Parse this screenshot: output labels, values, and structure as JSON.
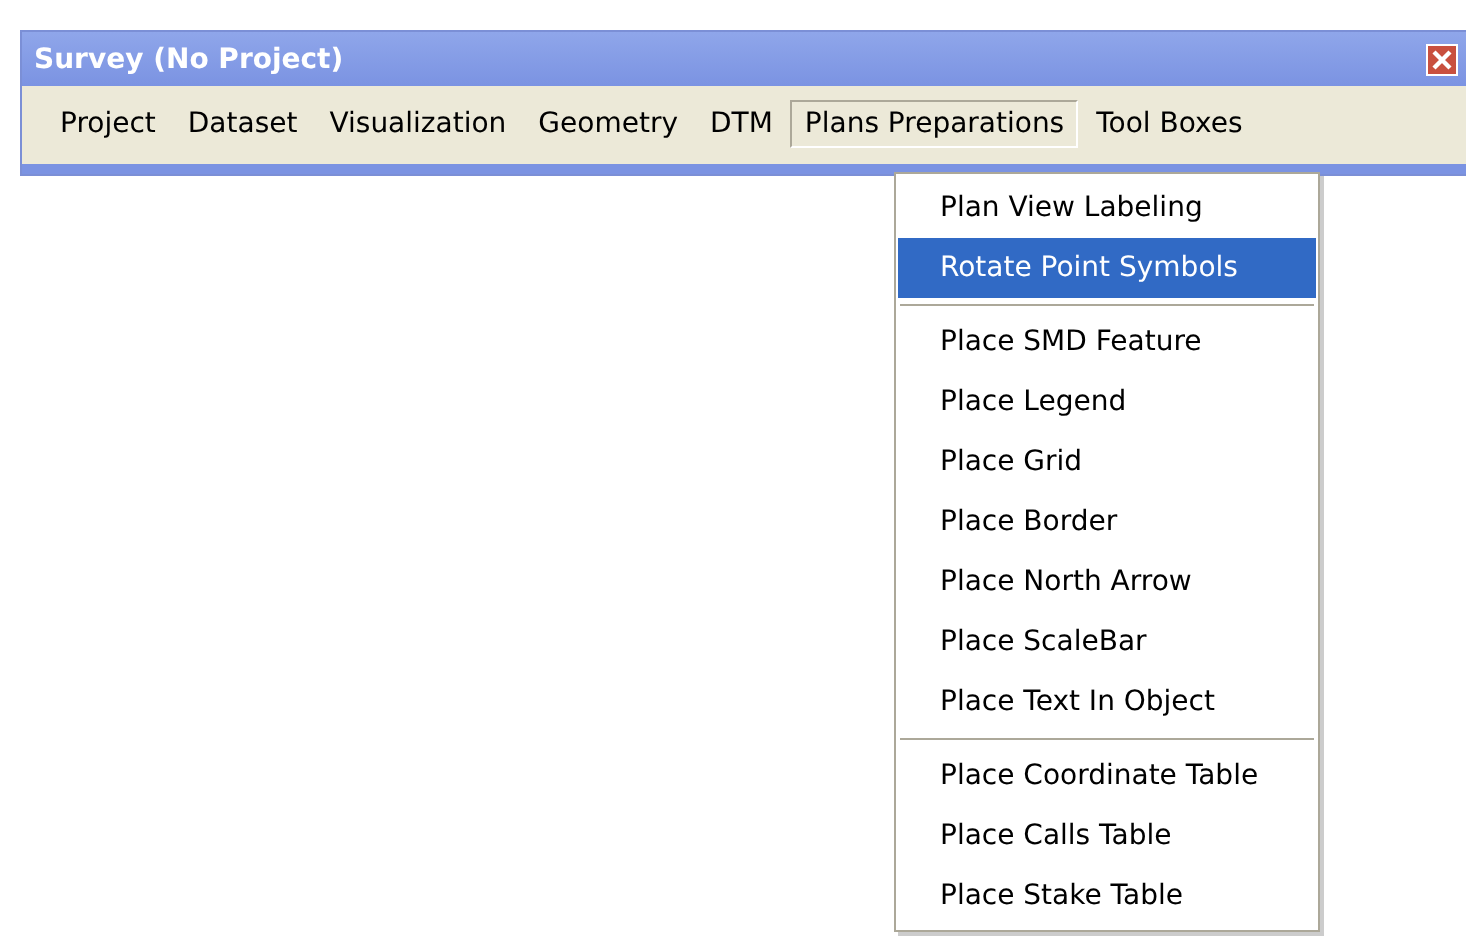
{
  "window": {
    "title": "Survey (No Project)"
  },
  "menu_bar": [
    {
      "label": "Project",
      "selected": false
    },
    {
      "label": "Dataset",
      "selected": false
    },
    {
      "label": "Visualization",
      "selected": false
    },
    {
      "label": "Geometry",
      "selected": false
    },
    {
      "label": "DTM",
      "selected": false
    },
    {
      "label": "Plans Preparations",
      "selected": true
    },
    {
      "label": "Tool Boxes",
      "selected": false
    }
  ],
  "dropdown": [
    {
      "kind": "item",
      "label": "Plan View Labeling",
      "selected": false
    },
    {
      "kind": "item",
      "label": "Rotate Point Symbols",
      "selected": true
    },
    {
      "kind": "separator"
    },
    {
      "kind": "item",
      "label": "Place SMD Feature",
      "selected": false
    },
    {
      "kind": "item",
      "label": "Place Legend",
      "selected": false
    },
    {
      "kind": "item",
      "label": "Place Grid",
      "selected": false
    },
    {
      "kind": "item",
      "label": "Place Border",
      "selected": false
    },
    {
      "kind": "item",
      "label": "Place North Arrow",
      "selected": false
    },
    {
      "kind": "item",
      "label": "Place ScaleBar",
      "selected": false
    },
    {
      "kind": "item",
      "label": "Place Text In Object",
      "selected": false
    },
    {
      "kind": "separator"
    },
    {
      "kind": "item",
      "label": "Place Coordinate Table",
      "selected": false
    },
    {
      "kind": "item",
      "label": "Place Calls Table",
      "selected": false
    },
    {
      "kind": "item",
      "label": "Place Stake Table",
      "selected": false
    }
  ]
}
